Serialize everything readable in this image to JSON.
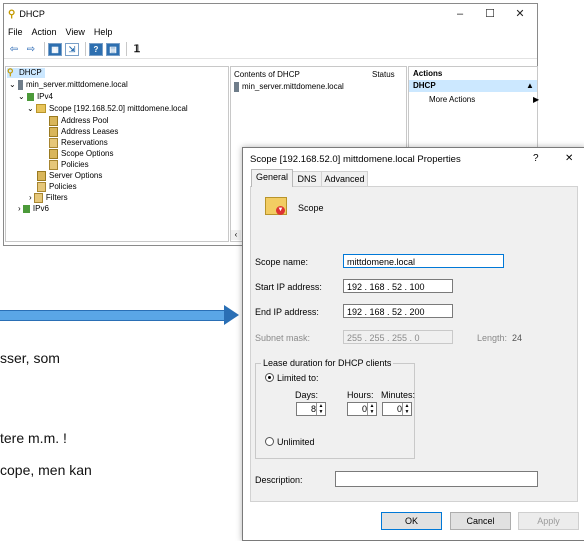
{
  "dhcp_window": {
    "title": "DHCP",
    "menu": [
      "File",
      "Action",
      "View",
      "Help"
    ],
    "controls": {
      "minimize": "–",
      "maximize": "☐",
      "close": "✕"
    },
    "tree": [
      {
        "label": "DHCP"
      },
      {
        "label": "min_server.mittdomene.local"
      },
      {
        "label": "IPv4"
      },
      {
        "label": "Scope [192.168.52.0] mittdomene.local"
      },
      {
        "label": "Address Pool"
      },
      {
        "label": "Address Leases"
      },
      {
        "label": "Reservations"
      },
      {
        "label": "Scope Options"
      },
      {
        "label": "Policies"
      },
      {
        "label": "Server Options"
      },
      {
        "label": "Policies"
      },
      {
        "label": "Filters"
      },
      {
        "label": "IPv6"
      }
    ],
    "contents": {
      "header_name": "Contents of DHCP",
      "header_status": "Status",
      "rows": [
        {
          "name": "min_server.mittdomene.local"
        }
      ]
    },
    "actions": {
      "header": "Actions",
      "selected": "DHCP",
      "more": "More Actions"
    }
  },
  "background_text": {
    "line1": "sser, som",
    "line2": "tere m.m. !",
    "line3": "cope, men kan"
  },
  "properties": {
    "title": "Scope [192.168.52.0] mittdomene.local Properties",
    "help": "?",
    "close": "✕",
    "tabs": [
      "General",
      "DNS",
      "Advanced"
    ],
    "scope_header": "Scope",
    "scope_name_label": "Scope name:",
    "scope_name_value": "mittdomene.local",
    "start_ip_label": "Start IP address:",
    "start_ip_value": "192 . 168 . 52 . 100",
    "end_ip_label": "End IP address:",
    "end_ip_value": "192 . 168 . 52 . 200",
    "subnet_label": "Subnet mask:",
    "subnet_value": "255 . 255 . 255 . 0",
    "length_label": "Length:",
    "length_value": "24",
    "lease_group": "Lease duration for DHCP clients",
    "limited_label": "Limited to:",
    "days_label": "Days:",
    "hours_label": "Hours:",
    "minutes_label": "Minutes:",
    "days_value": "8",
    "hours_value": "0",
    "minutes_value": "0",
    "unlimited_label": "Unlimited",
    "description_label": "Description:",
    "description_value": "",
    "ok": "OK",
    "cancel": "Cancel",
    "apply": "Apply"
  }
}
